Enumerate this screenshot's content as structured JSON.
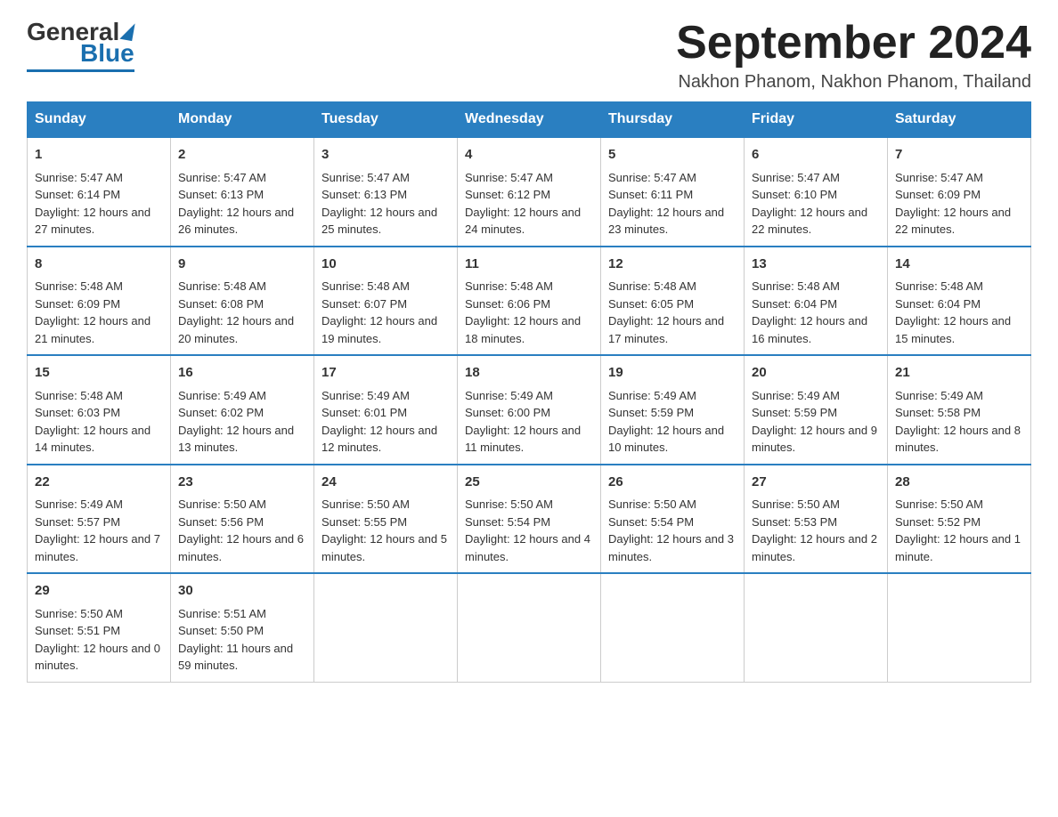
{
  "logo": {
    "general": "General",
    "blue": "Blue"
  },
  "title": "September 2024",
  "location": "Nakhon Phanom, Nakhon Phanom, Thailand",
  "days_of_week": [
    "Sunday",
    "Monday",
    "Tuesday",
    "Wednesday",
    "Thursday",
    "Friday",
    "Saturday"
  ],
  "weeks": [
    [
      {
        "day": 1,
        "sunrise": "Sunrise: 5:47 AM",
        "sunset": "Sunset: 6:14 PM",
        "daylight": "Daylight: 12 hours and 27 minutes."
      },
      {
        "day": 2,
        "sunrise": "Sunrise: 5:47 AM",
        "sunset": "Sunset: 6:13 PM",
        "daylight": "Daylight: 12 hours and 26 minutes."
      },
      {
        "day": 3,
        "sunrise": "Sunrise: 5:47 AM",
        "sunset": "Sunset: 6:13 PM",
        "daylight": "Daylight: 12 hours and 25 minutes."
      },
      {
        "day": 4,
        "sunrise": "Sunrise: 5:47 AM",
        "sunset": "Sunset: 6:12 PM",
        "daylight": "Daylight: 12 hours and 24 minutes."
      },
      {
        "day": 5,
        "sunrise": "Sunrise: 5:47 AM",
        "sunset": "Sunset: 6:11 PM",
        "daylight": "Daylight: 12 hours and 23 minutes."
      },
      {
        "day": 6,
        "sunrise": "Sunrise: 5:47 AM",
        "sunset": "Sunset: 6:10 PM",
        "daylight": "Daylight: 12 hours and 22 minutes."
      },
      {
        "day": 7,
        "sunrise": "Sunrise: 5:47 AM",
        "sunset": "Sunset: 6:09 PM",
        "daylight": "Daylight: 12 hours and 22 minutes."
      }
    ],
    [
      {
        "day": 8,
        "sunrise": "Sunrise: 5:48 AM",
        "sunset": "Sunset: 6:09 PM",
        "daylight": "Daylight: 12 hours and 21 minutes."
      },
      {
        "day": 9,
        "sunrise": "Sunrise: 5:48 AM",
        "sunset": "Sunset: 6:08 PM",
        "daylight": "Daylight: 12 hours and 20 minutes."
      },
      {
        "day": 10,
        "sunrise": "Sunrise: 5:48 AM",
        "sunset": "Sunset: 6:07 PM",
        "daylight": "Daylight: 12 hours and 19 minutes."
      },
      {
        "day": 11,
        "sunrise": "Sunrise: 5:48 AM",
        "sunset": "Sunset: 6:06 PM",
        "daylight": "Daylight: 12 hours and 18 minutes."
      },
      {
        "day": 12,
        "sunrise": "Sunrise: 5:48 AM",
        "sunset": "Sunset: 6:05 PM",
        "daylight": "Daylight: 12 hours and 17 minutes."
      },
      {
        "day": 13,
        "sunrise": "Sunrise: 5:48 AM",
        "sunset": "Sunset: 6:04 PM",
        "daylight": "Daylight: 12 hours and 16 minutes."
      },
      {
        "day": 14,
        "sunrise": "Sunrise: 5:48 AM",
        "sunset": "Sunset: 6:04 PM",
        "daylight": "Daylight: 12 hours and 15 minutes."
      }
    ],
    [
      {
        "day": 15,
        "sunrise": "Sunrise: 5:48 AM",
        "sunset": "Sunset: 6:03 PM",
        "daylight": "Daylight: 12 hours and 14 minutes."
      },
      {
        "day": 16,
        "sunrise": "Sunrise: 5:49 AM",
        "sunset": "Sunset: 6:02 PM",
        "daylight": "Daylight: 12 hours and 13 minutes."
      },
      {
        "day": 17,
        "sunrise": "Sunrise: 5:49 AM",
        "sunset": "Sunset: 6:01 PM",
        "daylight": "Daylight: 12 hours and 12 minutes."
      },
      {
        "day": 18,
        "sunrise": "Sunrise: 5:49 AM",
        "sunset": "Sunset: 6:00 PM",
        "daylight": "Daylight: 12 hours and 11 minutes."
      },
      {
        "day": 19,
        "sunrise": "Sunrise: 5:49 AM",
        "sunset": "Sunset: 5:59 PM",
        "daylight": "Daylight: 12 hours and 10 minutes."
      },
      {
        "day": 20,
        "sunrise": "Sunrise: 5:49 AM",
        "sunset": "Sunset: 5:59 PM",
        "daylight": "Daylight: 12 hours and 9 minutes."
      },
      {
        "day": 21,
        "sunrise": "Sunrise: 5:49 AM",
        "sunset": "Sunset: 5:58 PM",
        "daylight": "Daylight: 12 hours and 8 minutes."
      }
    ],
    [
      {
        "day": 22,
        "sunrise": "Sunrise: 5:49 AM",
        "sunset": "Sunset: 5:57 PM",
        "daylight": "Daylight: 12 hours and 7 minutes."
      },
      {
        "day": 23,
        "sunrise": "Sunrise: 5:50 AM",
        "sunset": "Sunset: 5:56 PM",
        "daylight": "Daylight: 12 hours and 6 minutes."
      },
      {
        "day": 24,
        "sunrise": "Sunrise: 5:50 AM",
        "sunset": "Sunset: 5:55 PM",
        "daylight": "Daylight: 12 hours and 5 minutes."
      },
      {
        "day": 25,
        "sunrise": "Sunrise: 5:50 AM",
        "sunset": "Sunset: 5:54 PM",
        "daylight": "Daylight: 12 hours and 4 minutes."
      },
      {
        "day": 26,
        "sunrise": "Sunrise: 5:50 AM",
        "sunset": "Sunset: 5:54 PM",
        "daylight": "Daylight: 12 hours and 3 minutes."
      },
      {
        "day": 27,
        "sunrise": "Sunrise: 5:50 AM",
        "sunset": "Sunset: 5:53 PM",
        "daylight": "Daylight: 12 hours and 2 minutes."
      },
      {
        "day": 28,
        "sunrise": "Sunrise: 5:50 AM",
        "sunset": "Sunset: 5:52 PM",
        "daylight": "Daylight: 12 hours and 1 minute."
      }
    ],
    [
      {
        "day": 29,
        "sunrise": "Sunrise: 5:50 AM",
        "sunset": "Sunset: 5:51 PM",
        "daylight": "Daylight: 12 hours and 0 minutes."
      },
      {
        "day": 30,
        "sunrise": "Sunrise: 5:51 AM",
        "sunset": "Sunset: 5:50 PM",
        "daylight": "Daylight: 11 hours and 59 minutes."
      },
      null,
      null,
      null,
      null,
      null
    ]
  ]
}
